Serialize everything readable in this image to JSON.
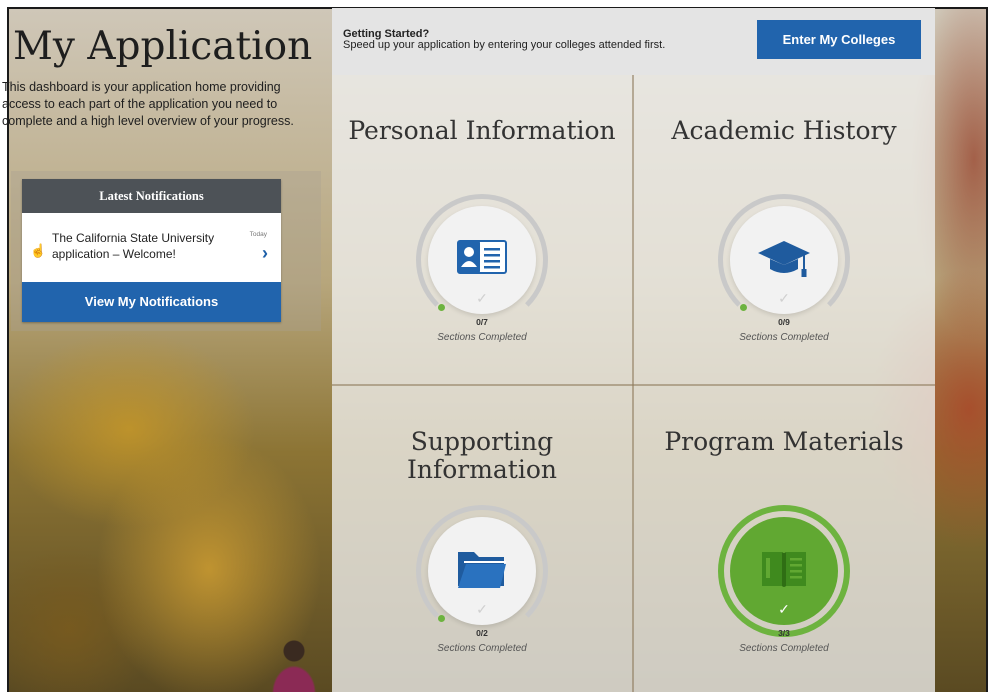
{
  "left": {
    "title": "My Application",
    "intro": "This dashboard is your application home providing access to each part of the application you need to complete and a high level overview of your progress.",
    "notifications": {
      "header": "Latest Notifications",
      "item_text": "The California State University application – Welcome!",
      "item_time": "Today",
      "button_label": "View My Notifications"
    }
  },
  "banner": {
    "title": "Getting Started?",
    "text": "Speed up your application by entering your colleges attended first.",
    "button_label": "Enter My Colleges"
  },
  "tiles": [
    {
      "title": "Personal Information",
      "count": "0/7",
      "caption": "Sections Completed",
      "icon": "id-card-icon",
      "completed_fraction": 0
    },
    {
      "title": "Academic History",
      "count": "0/9",
      "caption": "Sections Completed",
      "icon": "graduation-cap-icon",
      "completed_fraction": 0
    },
    {
      "title": "Supporting Information",
      "count": "0/2",
      "caption": "Sections Completed",
      "icon": "folder-icon",
      "completed_fraction": 0
    },
    {
      "title": "Program Materials",
      "count": "3/3",
      "caption": "Sections Completed",
      "icon": "book-icon",
      "completed_fraction": 1
    }
  ],
  "colors": {
    "primary_blue": "#2164ad",
    "progress_green": "#6db33f",
    "header_gray": "#4d5257"
  }
}
